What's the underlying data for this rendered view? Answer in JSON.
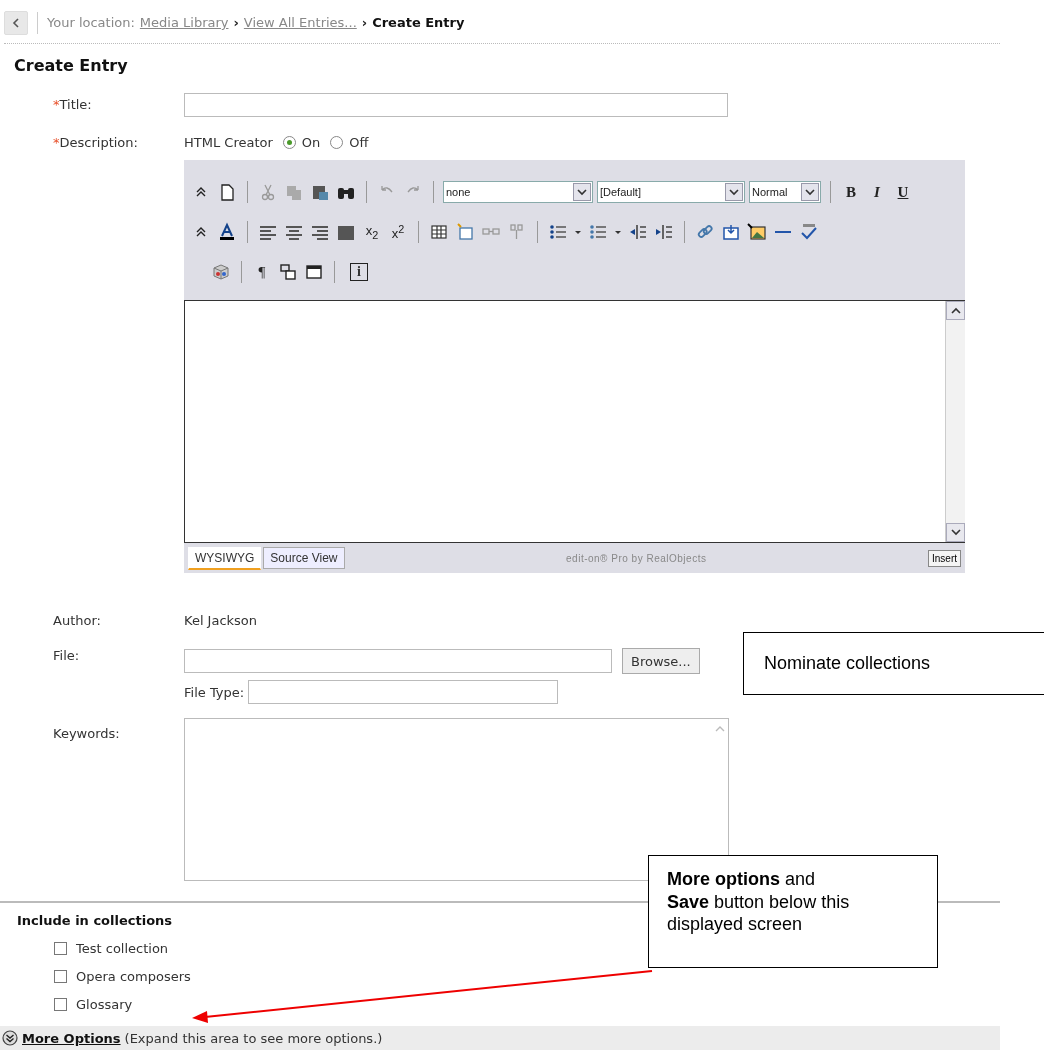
{
  "breadcrumb": {
    "label": "Your location:",
    "links": [
      "Media Library",
      "View All Entries..."
    ],
    "separators": [
      "›",
      "›"
    ],
    "current": "Create Entry"
  },
  "heading": "Create Entry",
  "title_field": {
    "required_mark": "*",
    "label": "Title:"
  },
  "description": {
    "required_mark": "*",
    "label": "Description:",
    "html_creator": {
      "label": "HTML Creator",
      "options": [
        {
          "label": "On",
          "selected": true
        },
        {
          "label": "Off",
          "selected": false
        }
      ]
    }
  },
  "editor": {
    "selects": [
      "none",
      "[Default]",
      "Normal"
    ],
    "format_chars": [
      "B",
      "I",
      "U"
    ],
    "subscript": "x$_{2}$",
    "superscript": "x$^{2}$",
    "pilcrow": "¶",
    "info": "i",
    "tabs": [
      {
        "label": "WYSIWYG",
        "selected": true
      },
      {
        "label": "Source View",
        "selected": false
      }
    ],
    "credit": "edit-on® Pro by RealObjects",
    "insert_button": "Insert"
  },
  "author": {
    "label": "Author:",
    "value": "Kel Jackson"
  },
  "file": {
    "label": "File:",
    "browse": "Browse...",
    "file_type_label": "File Type:"
  },
  "keywords": {
    "label": "Keywords:"
  },
  "collections": {
    "heading": "Include in collections",
    "items": [
      {
        "label": "Test collection",
        "checked": false
      },
      {
        "label": "Opera composers",
        "checked": false
      },
      {
        "label": "Glossary",
        "checked": false
      }
    ]
  },
  "more_options": {
    "link": "More Options",
    "note": "(Expand this area to see more options.)"
  },
  "callouts": [
    {
      "text": "Nominate collections"
    },
    {
      "text": "**More options** and\n**Save** button below this\ndisplayed screen"
    }
  ]
}
